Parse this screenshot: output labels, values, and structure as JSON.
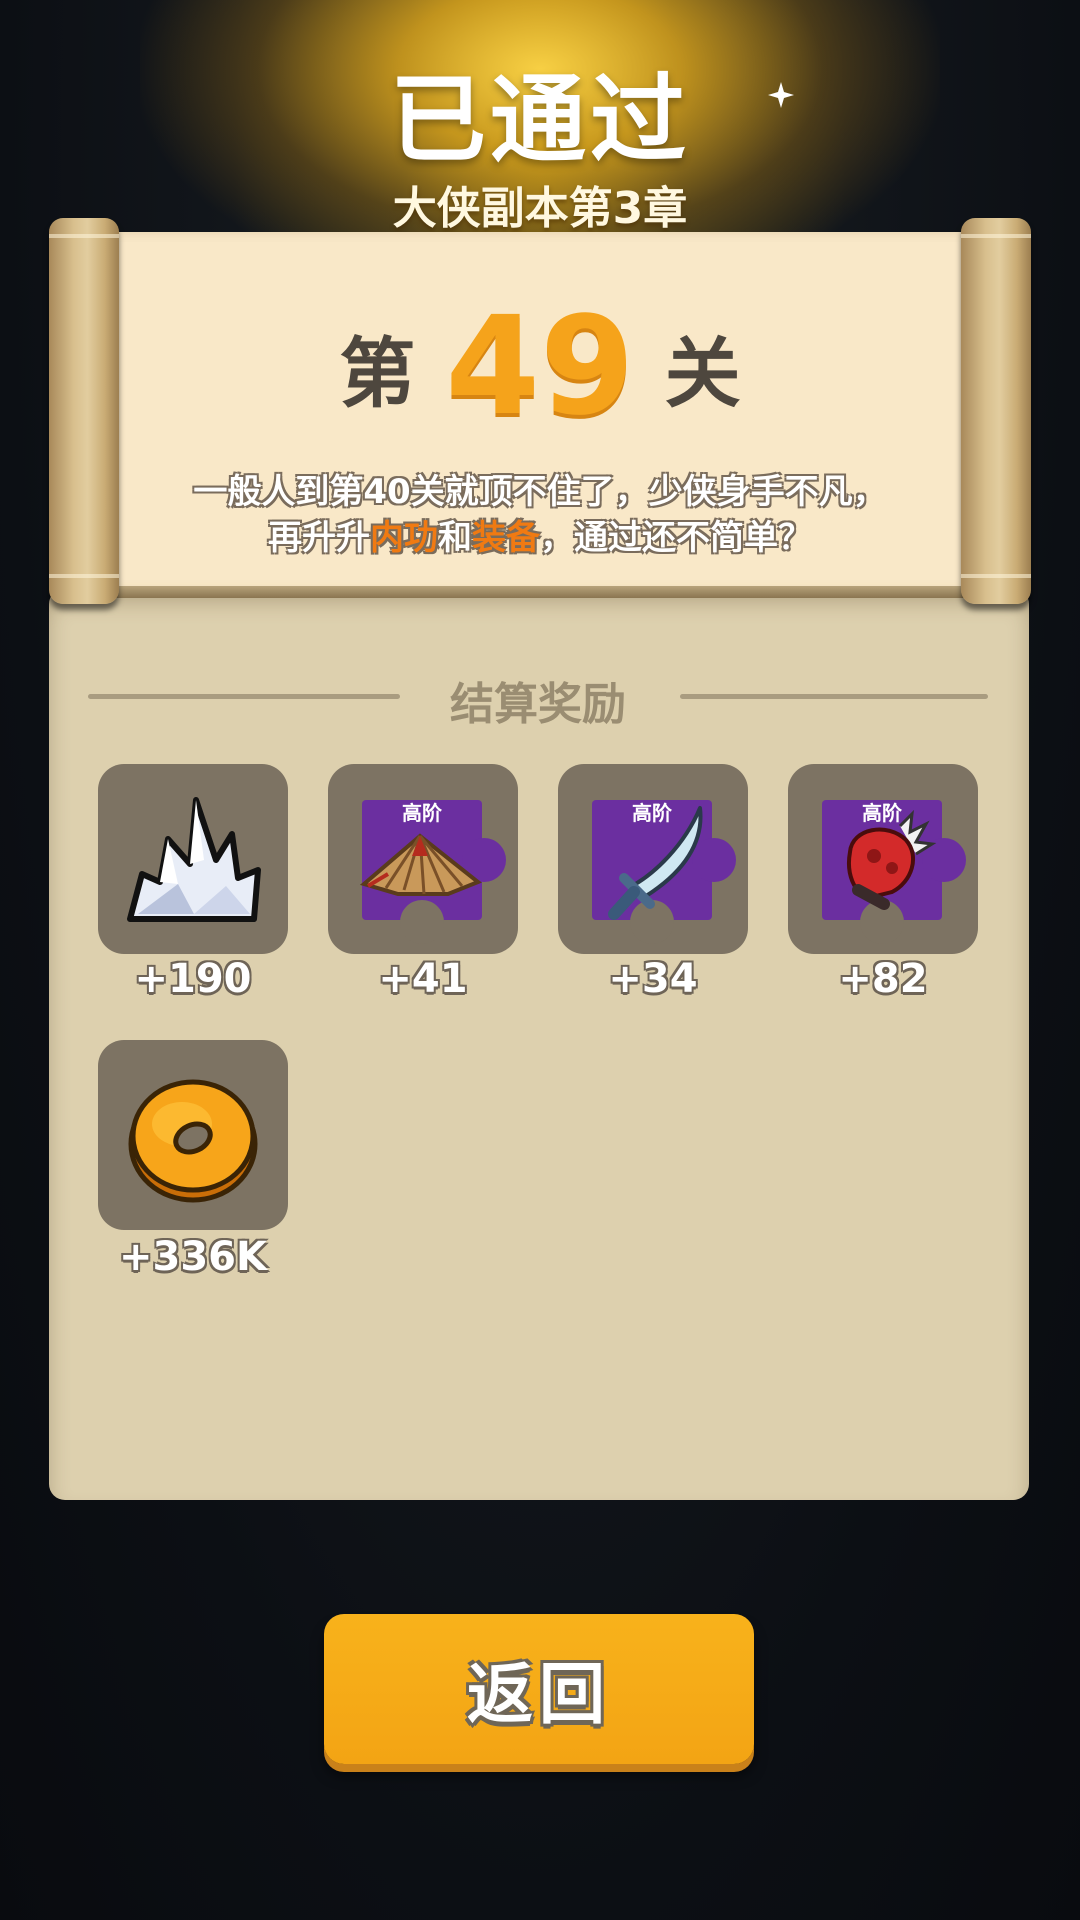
{
  "header": {
    "title": "已通过",
    "subtitle": "大侠副本第3章"
  },
  "level": {
    "prefix": "第",
    "number": "49",
    "suffix": "关"
  },
  "description": {
    "line1": "一般人到第40关就顶不住了，少侠身手不凡，",
    "line2_a": "再升升",
    "line2_hl1": "内功",
    "line2_b": "和",
    "line2_hl2": "装备",
    "line2_c": "，通过还不简单？"
  },
  "rewards": {
    "section_title": "结算奖励",
    "items": [
      {
        "icon": "crystal-icon",
        "tier": "",
        "amount": "+190"
      },
      {
        "icon": "straw-hat-icon",
        "tier": "高阶",
        "amount": "+41"
      },
      {
        "icon": "saber-icon",
        "tier": "高阶",
        "amount": "+34"
      },
      {
        "icon": "gauntlet-icon",
        "tier": "高阶",
        "amount": "+82"
      },
      {
        "icon": "gold-coin-icon",
        "tier": "",
        "amount": "+336K"
      }
    ]
  },
  "back_button": {
    "label": "返回"
  },
  "colors": {
    "accent_orange": "#f5a31b",
    "highlight_text": "#f07a12",
    "panel": "#ddd0ae",
    "paper": "#f9e8c8",
    "tile": "#7d7363",
    "fragment_purple": "#6b2fa0"
  }
}
